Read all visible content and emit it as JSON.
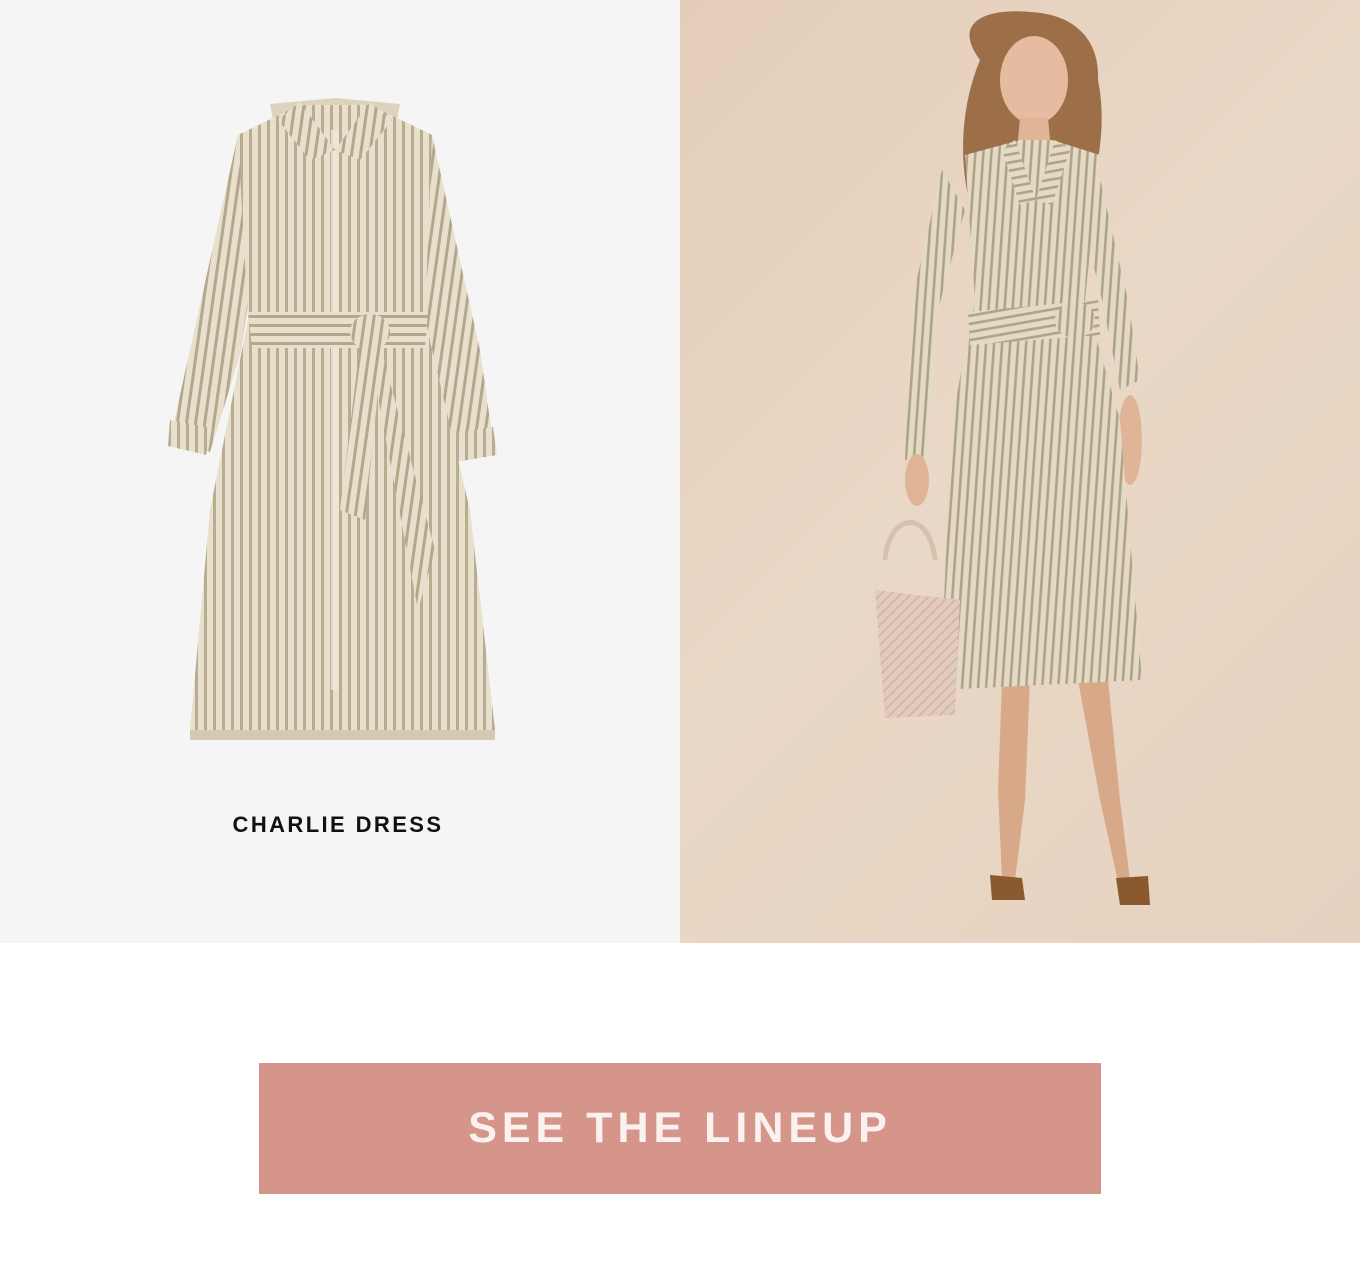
{
  "product": {
    "name": "CHARLIE DRESS",
    "image_alt": "Charlie Dress flat lay",
    "model_image_alt": "Model wearing Charlie Dress"
  },
  "cta": {
    "label": "SEE THE LINEUP"
  },
  "colors": {
    "left_background": "#f5f5f5",
    "right_background": "#e5d0bd",
    "dress_base": "#e6dcc8",
    "dress_stripe": "#b7ab90",
    "button": "#d5958b",
    "button_text": "#fbf2ef"
  }
}
